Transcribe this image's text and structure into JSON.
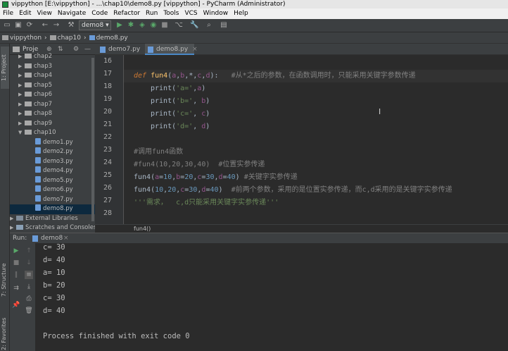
{
  "window": {
    "title": "vippython [E:\\vippython] - ...\\chap10\\demo8.py [vippython] - PyCharm (Administrator)"
  },
  "menu": [
    "File",
    "Edit",
    "View",
    "Navigate",
    "Code",
    "Refactor",
    "Run",
    "Tools",
    "VCS",
    "Window",
    "Help"
  ],
  "toolbar": {
    "run_config": "demo8"
  },
  "nav": {
    "project": "vippython",
    "folder": "chap10",
    "file": "demo8.py"
  },
  "project_panel": {
    "title": "Proje",
    "tree": [
      {
        "label": "chap2",
        "type": "folder",
        "level": 1,
        "expanded": false
      },
      {
        "label": "chap3",
        "type": "folder",
        "level": 1,
        "expanded": false
      },
      {
        "label": "chap4",
        "type": "folder",
        "level": 1,
        "expanded": false
      },
      {
        "label": "chap5",
        "type": "folder",
        "level": 1,
        "expanded": false
      },
      {
        "label": "chap6",
        "type": "folder",
        "level": 1,
        "expanded": false
      },
      {
        "label": "chap7",
        "type": "folder",
        "level": 1,
        "expanded": false
      },
      {
        "label": "chap8",
        "type": "folder",
        "level": 1,
        "expanded": false
      },
      {
        "label": "chap9",
        "type": "folder",
        "level": 1,
        "expanded": false
      },
      {
        "label": "chap10",
        "type": "folder",
        "level": 1,
        "expanded": true
      },
      {
        "label": "demo1.py",
        "type": "file",
        "level": 2
      },
      {
        "label": "demo2.py",
        "type": "file",
        "level": 2
      },
      {
        "label": "demo3.py",
        "type": "file",
        "level": 2
      },
      {
        "label": "demo4.py",
        "type": "file",
        "level": 2
      },
      {
        "label": "demo5.py",
        "type": "file",
        "level": 2
      },
      {
        "label": "demo6.py",
        "type": "file",
        "level": 2
      },
      {
        "label": "demo7.py",
        "type": "file",
        "level": 2
      },
      {
        "label": "demo8.py",
        "type": "file",
        "level": 2,
        "selected": true
      },
      {
        "label": "External Libraries",
        "type": "lib",
        "level": 0
      },
      {
        "label": "Scratches and Consoles",
        "type": "scratch",
        "level": 0
      }
    ]
  },
  "tabs": [
    {
      "label": "demo7.py",
      "active": false
    },
    {
      "label": "demo8.py",
      "active": true
    }
  ],
  "editor": {
    "line_numbers": [
      "16",
      "17",
      "18",
      "19",
      "20",
      "21",
      "22",
      "23",
      "24",
      "25",
      "26",
      "27",
      "28"
    ],
    "breadcrumb": "fun4()"
  },
  "left_strip": {
    "project": "1: Project",
    "structure": "7: Structure",
    "favorites": "2: Favorites"
  },
  "run": {
    "label": "Run:",
    "tab": "demo8",
    "output": [
      "c= 30",
      "d= 40",
      "a= 10",
      "b= 20",
      "c= 30",
      "d= 40",
      "",
      "Process finished with exit code 0"
    ]
  },
  "colors": {
    "keyword": "#cc7832",
    "string": "#6a8759",
    "number": "#6897bb",
    "comment": "#808080",
    "param": "#94558d",
    "function": "#ffc66d"
  }
}
